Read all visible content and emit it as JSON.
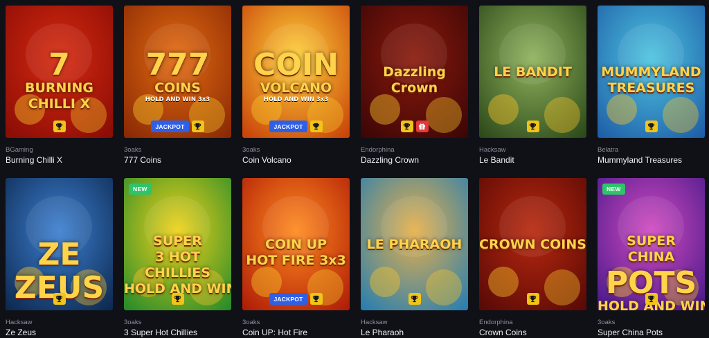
{
  "games": [
    {
      "provider": "BGaming",
      "name": "Burning Chilli X",
      "art_lines": [
        "7",
        "BURNING",
        "CHILLI X"
      ],
      "badges": [
        "trophy-icon"
      ],
      "is_new": false,
      "colors": [
        "#8a0d06",
        "#d6290f"
      ]
    },
    {
      "provider": "3oaks",
      "name": "777 Coins",
      "art_lines": [
        "777",
        "COINS",
        "HOLD AND WIN 3x3"
      ],
      "badges": [
        "jackpot",
        "trophy-icon"
      ],
      "is_new": false,
      "colors": [
        "#8a2a05",
        "#e36a10"
      ]
    },
    {
      "provider": "3oaks",
      "name": "Coin Volcano",
      "art_lines": [
        "COIN",
        "VOLCANO",
        "HOLD AND WIN 3x3"
      ],
      "badges": [
        "jackpot",
        "trophy-icon"
      ],
      "is_new": false,
      "colors": [
        "#c9440a",
        "#ffd23a"
      ]
    },
    {
      "provider": "Endorphina",
      "name": "Dazzling Crown",
      "art_lines": [
        "Dazzling",
        "Crown"
      ],
      "badges": [
        "trophy-icon",
        "gift-icon"
      ],
      "is_new": false,
      "colors": [
        "#3d0606",
        "#8a1a0c"
      ]
    },
    {
      "provider": "Hacksaw",
      "name": "Le Bandit",
      "art_lines": [
        "LE BANDIT"
      ],
      "badges": [
        "trophy-icon"
      ],
      "is_new": false,
      "colors": [
        "#2d4a1a",
        "#8fb25c"
      ]
    },
    {
      "provider": "Belatra",
      "name": "Mummyland Treasures",
      "art_lines": [
        "MUMMYLAND",
        "TREASURES"
      ],
      "badges": [
        "trophy-icon"
      ],
      "is_new": false,
      "colors": [
        "#1f5fa8",
        "#4ec4e0"
      ]
    },
    {
      "provider": "Hacksaw",
      "name": "Ze Zeus",
      "art_lines": [
        "ZE",
        "ZEUS"
      ],
      "badges": [
        "trophy-icon"
      ],
      "is_new": false,
      "colors": [
        "#0e2a52",
        "#3c7fd0"
      ]
    },
    {
      "provider": "3oaks",
      "name": "3 Super Hot Chillies",
      "art_lines": [
        "SUPER",
        "3 HOT",
        "CHILLIES",
        "HOLD AND WIN"
      ],
      "badges": [
        "trophy-icon"
      ],
      "is_new": true,
      "colors": [
        "#2a8c2a",
        "#f0d21a"
      ]
    },
    {
      "provider": "3oaks",
      "name": "Coin UP: Hot Fire",
      "art_lines": [
        "COIN UP",
        "HOT FIRE 3x3"
      ],
      "badges": [
        "jackpot",
        "trophy-icon"
      ],
      "is_new": false,
      "colors": [
        "#b01e08",
        "#ff8a1e"
      ]
    },
    {
      "provider": "Hacksaw",
      "name": "Le Pharaoh",
      "art_lines": [
        "LE PHARAOH"
      ],
      "badges": [
        "trophy-icon"
      ],
      "is_new": false,
      "colors": [
        "#2a7fb0",
        "#e7b04a"
      ]
    },
    {
      "provider": "Endorphina",
      "name": "Crown Coins",
      "art_lines": [
        "CROWN COINS"
      ],
      "badges": [
        "trophy-icon"
      ],
      "is_new": false,
      "colors": [
        "#5a0a06",
        "#b8280e"
      ]
    },
    {
      "provider": "3oaks",
      "name": "Super China Pots",
      "art_lines": [
        "SUPER",
        "CHINA",
        "POTS",
        "HOLD AND WIN"
      ],
      "badges": [
        "trophy-icon"
      ],
      "is_new": true,
      "colors": [
        "#4a1a8a",
        "#d04ac0"
      ]
    }
  ],
  "labels": {
    "jackpot": "JACKPOT",
    "new": "NEW"
  }
}
